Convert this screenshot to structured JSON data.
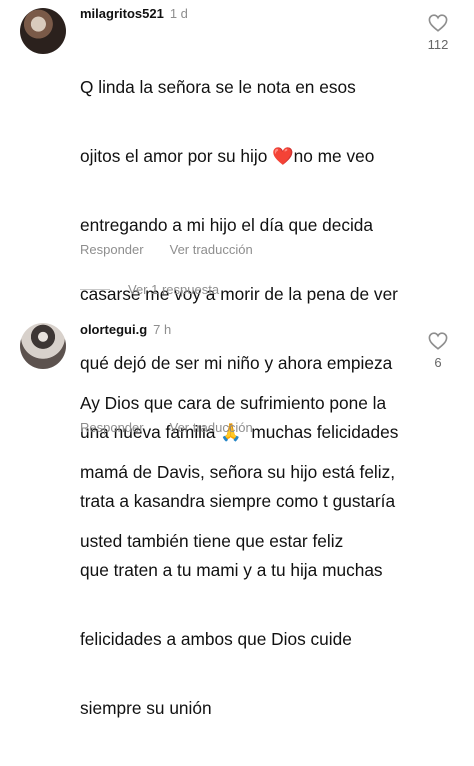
{
  "comments": [
    {
      "username": "milagritos521",
      "time": "1 d",
      "lines": [
        "Q linda la señora se le nota en esos",
        "ojitos el amor por su hijo ❤️no me veo",
        "entregando a mi hijo el día que decida",
        "casarse me voy a morir de la pena de ver",
        "qué dejó de ser mi niño y ahora empieza",
        "una nueva familia 🙏  muchas felicidades",
        "trata a kasandra siempre como t gustaría",
        "que traten a tu mami y a tu hija muchas",
        "felicidades a ambos que Dios cuide",
        "siempre su unión"
      ],
      "reply_label": "Responder",
      "translate_label": "Ver traducción",
      "likes": "112",
      "view_replies": "Ver 1 respuesta"
    },
    {
      "username": "olortegui.g",
      "time": "7 h",
      "lines": [
        "Ay Dios que cara de sufrimiento pone la",
        "mamá de Davis, señora su hijo está feliz,",
        "usted también tiene que estar feliz"
      ],
      "reply_label": "Responder",
      "translate_label": "Ver traducción",
      "likes": "6"
    }
  ],
  "icons": {
    "like": "heart-outline-icon"
  },
  "colors": {
    "secondary_text": "#8e8e8e",
    "primary_text": "#111111"
  }
}
